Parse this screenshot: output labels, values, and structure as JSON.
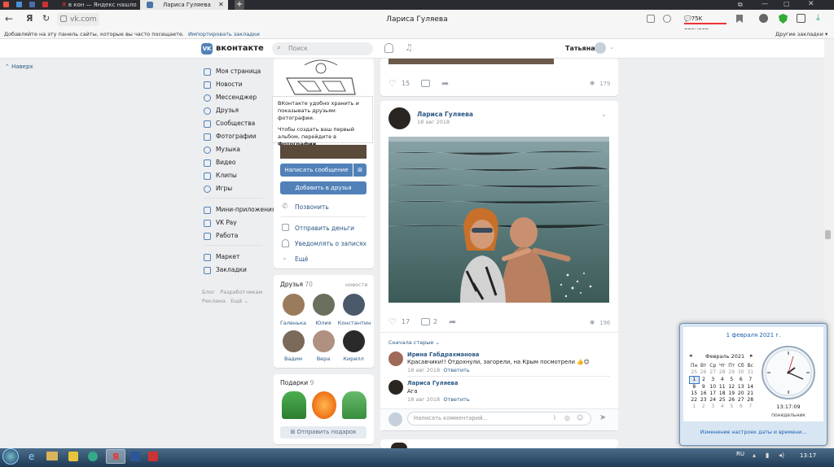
{
  "browser": {
    "tabs": [
      {
        "label": "в кон — Яндекс нашлось",
        "active": false
      },
      {
        "label": "Лариса Гуляева",
        "active": true
      }
    ],
    "url": "vk.com",
    "page_title": "Лариса Гуляева",
    "reviews_badge": "75K отзывов",
    "bookmarks_hint": "Добавляйте на эту панель сайты, которые вы часто посещаете.",
    "import_bookmarks": "Импортировать закладки",
    "other_bookmarks": "Другие закладки"
  },
  "vk": {
    "logo": "вконтакте",
    "search_placeholder": "Поиск",
    "user_name": "Татьяна",
    "back_to_top": "Наверх",
    "nav": [
      {
        "label": "Моя страница",
        "icon": "home-icon"
      },
      {
        "label": "Новости",
        "icon": "news-icon"
      },
      {
        "label": "Мессенджер",
        "icon": "message-icon"
      },
      {
        "label": "Друзья",
        "icon": "friends-icon"
      },
      {
        "label": "Сообщества",
        "icon": "groups-icon"
      },
      {
        "label": "Фотографии",
        "icon": "photo-icon"
      },
      {
        "label": "Музыка",
        "icon": "music-icon"
      },
      {
        "label": "Видео",
        "icon": "video-icon"
      },
      {
        "label": "Клипы",
        "icon": "clips-icon"
      },
      {
        "label": "Игры",
        "icon": "games-icon"
      },
      {
        "label": "Мини-приложения",
        "icon": "apps-icon"
      },
      {
        "label": "VK Pay",
        "icon": "pay-icon"
      },
      {
        "label": "Работа",
        "icon": "work-icon"
      },
      {
        "label": "Маркет",
        "icon": "market-icon"
      },
      {
        "label": "Закладки",
        "icon": "bookmark-icon"
      }
    ],
    "footer_links": [
      "Блог",
      "Разработчикам",
      "Реклама",
      "Ещё ⌄"
    ],
    "tooltip": {
      "line1": "ВКонтакте удобно хранить и показывать друзьям фотографии.",
      "line2_prefix": "Чтобы создать ваш первый альбом, перейдите в ",
      "line2_link": "Фотографии",
      "line2_suffix": "."
    },
    "profile_actions": {
      "write_message": "Написать сообщение",
      "add_friend": "Добавить в друзья",
      "call": "Позвонить",
      "send_money": "Отправить деньги",
      "notify": "Уведомлять о записях",
      "more": "Ещё"
    },
    "friends_block": {
      "title": "Друзья",
      "count": "70",
      "updates": "новости",
      "friends": [
        "Галенька",
        "Юлия",
        "Константин",
        "Вадим",
        "Вера",
        "Кирилл"
      ]
    },
    "gifts_block": {
      "title": "Подарки",
      "count": "9",
      "send_gift": "Отправить подарок"
    },
    "post_prev": {
      "likes": "15",
      "views": "179"
    },
    "post": {
      "author": "Лариса Гуляева",
      "date": "18 авг 2018",
      "likes": "17",
      "comments": "2",
      "views": "196",
      "sort_label": "Сначала старые ⌄",
      "comments_list": [
        {
          "author": "Ирина Габдрахманова",
          "text": "Красавчики!! Отдохнули, загорели, на Крым посмотрели 👍😊",
          "date": "18 авг 2018",
          "reply": "Ответить"
        },
        {
          "author": "Лариса Гуляева",
          "text": "Ага",
          "date": "18 авг 2018",
          "reply": "Ответить"
        }
      ],
      "comment_placeholder": "Написать комментарий..."
    }
  },
  "clock_popup": {
    "date_header": "1 февраля 2021 г.",
    "month": "Февраль 2021",
    "weekdays": [
      "Пн",
      "Вт",
      "Ср",
      "Чт",
      "Пт",
      "Сб",
      "Вс"
    ],
    "weeks": [
      [
        "25",
        "26",
        "27",
        "28",
        "29",
        "30",
        "31"
      ],
      [
        "1",
        "2",
        "3",
        "4",
        "5",
        "6",
        "7"
      ],
      [
        "8",
        "9",
        "10",
        "11",
        "12",
        "13",
        "14"
      ],
      [
        "15",
        "16",
        "17",
        "18",
        "19",
        "20",
        "21"
      ],
      [
        "22",
        "23",
        "24",
        "25",
        "26",
        "27",
        "28"
      ],
      [
        "1",
        "2",
        "3",
        "4",
        "5",
        "6",
        "7"
      ]
    ],
    "time": "13:17:09",
    "day_name": "понедельник",
    "settings_link": "Изменение настроек даты и времени..."
  },
  "taskbar": {
    "lang": "RU",
    "time": "13:17"
  },
  "colors": {
    "vk_blue": "#5181b8",
    "link": "#2a5885",
    "bg": "#edeef0"
  }
}
